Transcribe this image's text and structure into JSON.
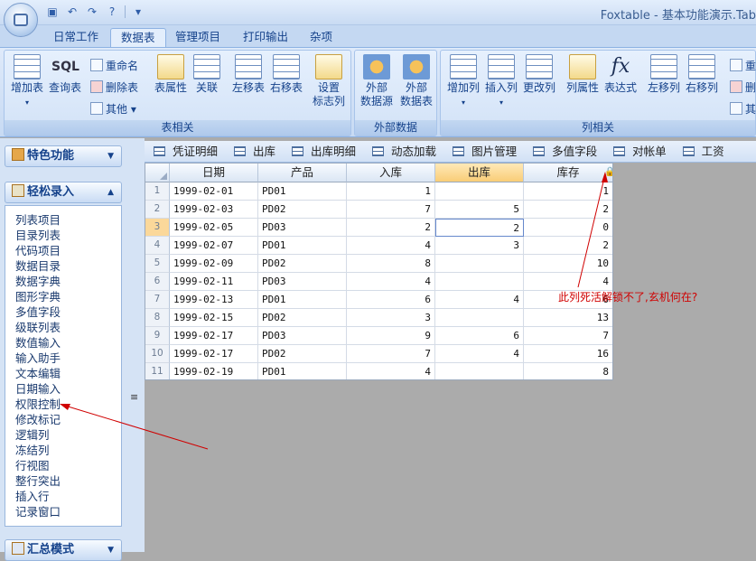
{
  "window": {
    "title": "Foxtable - 基本功能演示.Tab"
  },
  "ribbon_tabs": [
    {
      "label": "日常工作"
    },
    {
      "label": "数据表",
      "active": true
    },
    {
      "label": "管理项目"
    },
    {
      "label": "打印输出"
    },
    {
      "label": "杂项"
    }
  ],
  "ribbon": {
    "group_table": {
      "label": "表相关",
      "add_table": "增加表",
      "query_table": "查询表",
      "rename": "重命名",
      "delete_table": "删除表",
      "other": "其他",
      "table_props": "表属性",
      "relation": "关联",
      "move_table_left": "左移表",
      "move_table_right": "右移表",
      "set_flag_col": "设置\n标志列"
    },
    "group_external": {
      "label": "外部数据",
      "ext_source": "外部\n数据源",
      "ext_table": "外部\n数据表"
    },
    "group_column": {
      "label": "列相关",
      "add_col": "增加列",
      "insert_col": "插入列",
      "change_col": "更改列",
      "col_props": "列属性",
      "expression": "表达式",
      "move_col_left": "左移列",
      "move_col_right": "右移列",
      "cut_1": "重",
      "cut_2": "删",
      "cut_3": "其"
    }
  },
  "sidebar": {
    "panel_special": "特色功能",
    "panel_easy": "轻松录入",
    "panel_summary": "汇总模式",
    "items": [
      "列表项目",
      "目录列表",
      "代码项目",
      "数据目录",
      "数据字典",
      "图形字典",
      "多值字段",
      "级联列表",
      "数值输入",
      "输入助手",
      "文本编辑",
      "日期输入",
      "权限控制",
      "修改标记",
      "逻辑列",
      "冻结列",
      "行视图",
      "整行突出",
      "插入行",
      "记录窗口"
    ]
  },
  "doc_tabs": [
    "凭证明细",
    "出库",
    "出库明细",
    "动态加载",
    "图片管理",
    "多值字段",
    "对帐单",
    "工资"
  ],
  "table": {
    "columns": [
      "日期",
      "产品",
      "入库",
      "出库",
      "库存"
    ],
    "selected_column": "出库",
    "current_row": 3,
    "rows": [
      {
        "no": "1",
        "date": "1999-02-01",
        "product": "PD01",
        "in": "1",
        "out": "",
        "stock": "1"
      },
      {
        "no": "2",
        "date": "1999-02-03",
        "product": "PD02",
        "in": "7",
        "out": "5",
        "stock": "2"
      },
      {
        "no": "3",
        "date": "1999-02-05",
        "product": "PD03",
        "in": "2",
        "out": "2",
        "stock": "0"
      },
      {
        "no": "4",
        "date": "1999-02-07",
        "product": "PD01",
        "in": "4",
        "out": "3",
        "stock": "2"
      },
      {
        "no": "5",
        "date": "1999-02-09",
        "product": "PD02",
        "in": "8",
        "out": "",
        "stock": "10"
      },
      {
        "no": "6",
        "date": "1999-02-11",
        "product": "PD03",
        "in": "4",
        "out": "",
        "stock": "4"
      },
      {
        "no": "7",
        "date": "1999-02-13",
        "product": "PD01",
        "in": "6",
        "out": "4",
        "stock": "6"
      },
      {
        "no": "8",
        "date": "1999-02-15",
        "product": "PD02",
        "in": "3",
        "out": "",
        "stock": "13"
      },
      {
        "no": "9",
        "date": "1999-02-17",
        "product": "PD03",
        "in": "9",
        "out": "6",
        "stock": "7"
      },
      {
        "no": "10",
        "date": "1999-02-17",
        "product": "PD02",
        "in": "7",
        "out": "4",
        "stock": "16"
      },
      {
        "no": "11",
        "date": "1999-02-19",
        "product": "PD01",
        "in": "4",
        "out": "",
        "stock": "8"
      }
    ]
  },
  "annotation": {
    "text": "此列死活解锁不了,玄机何在?",
    "color": "#d00000"
  }
}
